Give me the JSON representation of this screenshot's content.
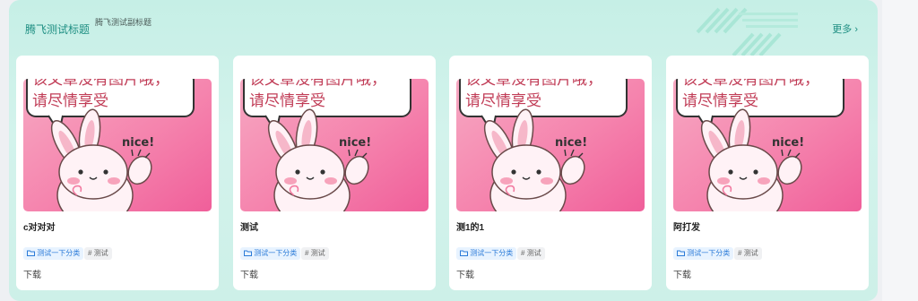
{
  "section": {
    "title": "腾飞测试标题",
    "subtitle": "腾飞测试副标题",
    "more_label": "更多",
    "more_chevron": "›"
  },
  "image_text": {
    "bubble_line1": "该文章没有图片哦，",
    "bubble_line2": "请尽情享受",
    "nice": "nice!"
  },
  "cards": [
    {
      "name": "c对对对",
      "category": "测试一下分类",
      "tag": "测试",
      "download": "下载"
    },
    {
      "name": "测试",
      "category": "测试一下分类",
      "tag": "测试",
      "download": "下载"
    },
    {
      "name": "测1的1",
      "category": "测试一下分类",
      "tag": "测试",
      "download": "下载"
    },
    {
      "name": "阿打发",
      "category": "测试一下分类",
      "tag": "测试",
      "download": "下载"
    }
  ],
  "colors": {
    "accent": "#1f8f83",
    "tag_blue": "#2b7bd8",
    "panel_bg": "#cdf0e8"
  },
  "icons": {
    "folder": "folder-icon",
    "hash": "hash-icon",
    "more": "chevron-right-icon"
  }
}
